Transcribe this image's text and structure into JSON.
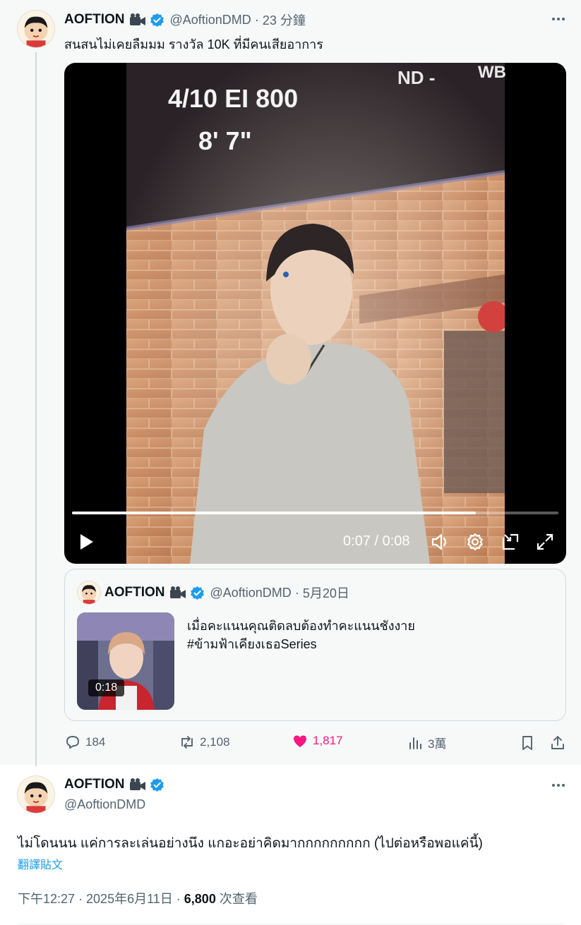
{
  "parent_tweet": {
    "display_name": "AOFTION",
    "handle": "@AoftionDMD",
    "time": "23 分鐘",
    "text": "สนสนไม่เคยลืมมม รางวัล 10K ที่มีคนเสียอาการ",
    "video": {
      "overlay_line1": "4/10   EI 800",
      "overlay_line2": "8'  7\"",
      "overlay_corner": "ND -",
      "overlay_wb": "WB",
      "time_display": "0:07 / 0:08",
      "progress": 0.83
    },
    "quote": {
      "display_name": "AOFTION",
      "handle": "@AoftionDMD",
      "time": "5月20日",
      "text_line1": "เมื่อคะแนนคุณติดลบต้องทำคะแนนชังงาย",
      "text_line2": "#ข้ามฟ้าเคียงเธอSeries",
      "thumb_duration": "0:18"
    },
    "actions": {
      "replies": "184",
      "retweets": "2,108",
      "likes": "1,817",
      "views": "3萬"
    }
  },
  "main_tweet": {
    "display_name": "AOFTION",
    "handle": "@AoftionDMD",
    "text": "ไม่โดนนน แค่การละเล่นอย่างนึง แกอะอย่าคิดมากกกกกกกกก (ไปต่อหรือพอแค่นี้)",
    "translate_label": "翻譯貼文",
    "timestamp": "下午12:27 · 2025年6月11日 · ",
    "views_count": "6,800",
    "views_label": " 次查看"
  },
  "colors": {
    "accent": "#1d9bf0",
    "like": "#f91880",
    "muted": "#536471"
  },
  "icons": [
    "camera-icon",
    "verified-icon",
    "more-icon",
    "play-icon",
    "volume-icon",
    "settings-icon",
    "pip-icon",
    "fullscreen-icon",
    "reply-icon",
    "retweet-icon",
    "heart-icon",
    "views-icon",
    "bookmark-icon",
    "share-icon"
  ]
}
